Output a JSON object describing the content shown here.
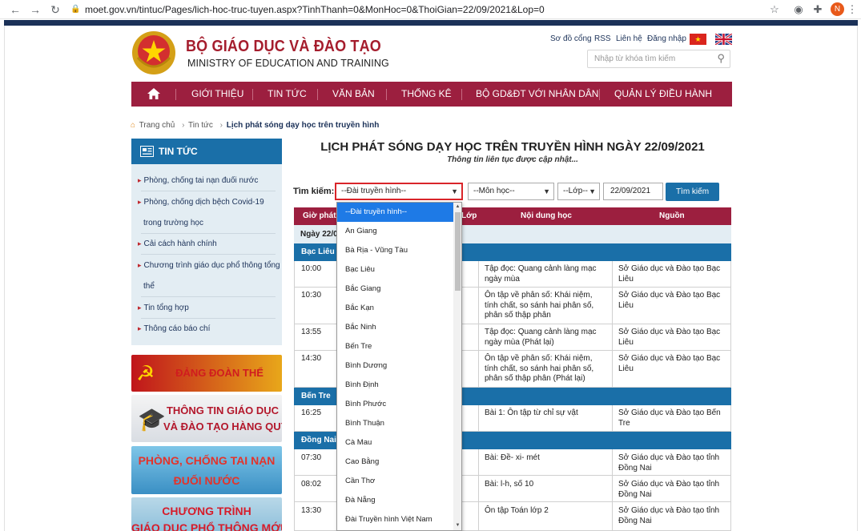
{
  "browser": {
    "url": "moet.gov.vn/tintuc/Pages/lich-hoc-truc-tuyen.aspx?TinhThanh=0&MonHoc=0&ThoiGian=22/09/2021&Lop=0",
    "profile_initial": "N"
  },
  "header": {
    "title": "BỘ GIÁO DỤC VÀ ĐÀO TẠO",
    "subtitle": "MINISTRY OF EDUCATION AND TRAINING",
    "links": [
      "Sơ đồ cổng",
      "RSS",
      "Liên hệ",
      "Đăng nhập"
    ],
    "search_placeholder": "Nhập từ khóa tìm kiếm"
  },
  "nav": {
    "items": [
      "GIỚI THIỆU",
      "TIN TỨC",
      "VĂN BẢN",
      "THỐNG KÊ",
      "BỘ GD&ĐT VỚI NHÂN DÂN",
      "QUẢN LÝ ĐIỀU HÀNH"
    ]
  },
  "breadcrumb": {
    "home": "Trang chủ",
    "section": "Tin tức",
    "current": "Lịch phát sóng dạy học trên truyền hình"
  },
  "sidebar": {
    "heading": "TIN TỨC",
    "items": [
      {
        "label": "Phòng, chống tai nạn đuối nước"
      },
      {
        "label": "Phòng, chống dịch bệch Covid-19",
        "label2": "trong trường học"
      },
      {
        "label": "Cải cách hành chính"
      },
      {
        "label": "Chương trình giáo dục phổ thông tổng",
        "label2": "thể"
      },
      {
        "label": "Tin tổng hợp"
      },
      {
        "label": "Thông cáo báo chí"
      }
    ],
    "banners": [
      {
        "line1": "ĐẢNG ĐOÀN THỂ"
      },
      {
        "line1": "THÔNG TIN GIÁO DỤC",
        "line2": "VÀ ĐÀO TẠO HÀNG QUÝ"
      },
      {
        "line1": "PHÒNG, CHỐNG TAI NẠN",
        "line2": "ĐUỐI NƯỚC"
      },
      {
        "line1": "CHƯƠNG TRÌNH",
        "line2": "GIÁO DỤC PHỔ THÔNG MỚI"
      }
    ]
  },
  "content": {
    "title": "LỊCH PHÁT SÓNG DẠY HỌC TRÊN TRUYỀN HÌNH NGÀY 22/09/2021",
    "subtitle": "Thông tin liên tục được cập nhật...",
    "filter_label": "Tìm kiếm:",
    "filters": {
      "dai": "--Đài truyền hình--",
      "mon": "--Môn học--",
      "lop": "--Lớp--",
      "date": "22/09/2021",
      "button": "Tìm kiếm"
    },
    "columns": [
      "Giờ phát",
      "Lớp",
      "Nội dung học",
      "Nguồn"
    ],
    "date_row": "Ngày 22/0",
    "groups": [
      {
        "province": "Bạc Liêu",
        "rows": [
          {
            "time": "10:00",
            "content": [
              "Tập đọc: Quang cảnh làng mạc",
              "ngày mùa"
            ],
            "source": [
              "Sở Giáo dục và Đào tạo Bạc",
              "Liêu"
            ]
          },
          {
            "time": "10:30",
            "content": [
              "Ôn tập về phân số: Khái niệm,",
              "tính chất, so sánh hai phân số,",
              "phân số thập phân"
            ],
            "source": [
              "Sở Giáo dục và Đào tạo Bạc",
              "Liêu"
            ]
          },
          {
            "time": "13:55",
            "content": [
              "Tập đọc: Quang cảnh làng mạc",
              "ngày mùa (Phát lại)"
            ],
            "source": [
              "Sở Giáo dục và Đào tạo Bạc",
              "Liêu"
            ]
          },
          {
            "time": "14:30",
            "content": [
              "Ôn tập về phân số: Khái niệm,",
              "tính chất, so sánh hai phân số,",
              "phân số thập phân (Phát lại)"
            ],
            "source": [
              "Sở Giáo dục và Đào tạo Bạc",
              "Liêu"
            ]
          }
        ]
      },
      {
        "province": "Bến Tre",
        "rows": [
          {
            "time": "16:25",
            "content": [
              "Bài 1: Ôn tập từ chỉ sự vật"
            ],
            "source": [
              "Sở Giáo dục và Đào tạo Bến",
              "Tre"
            ]
          }
        ]
      },
      {
        "province": "Đồng Nai",
        "rows": [
          {
            "time": "07:30",
            "content": [
              "Bài: Đề- xi- mét"
            ],
            "source": [
              "Sở Giáo dục và Đào tạo tỉnh",
              "Đồng Nai"
            ]
          },
          {
            "time": "08:02",
            "content": [
              "Bài: l-h, số 10"
            ],
            "source": [
              "Sở Giáo dục và Đào tạo tỉnh",
              "Đồng Nai"
            ]
          },
          {
            "time": "13:30",
            "content": [
              "Ôn tập Toán lớp 2"
            ],
            "source": [
              "Sở Giáo dục và Đào tạo tỉnh",
              "Đồng Nai"
            ]
          }
        ]
      }
    ]
  },
  "dropdown": {
    "options": [
      "--Đài truyền hình--",
      "An Giang",
      "Bà Rịa - Vũng Tàu",
      "Bạc Liêu",
      "Bắc Giang",
      "Bắc Kạn",
      "Bắc Ninh",
      "Bến Tre",
      "Bình Dương",
      "Bình Định",
      "Bình Phước",
      "Bình Thuận",
      "Cà Mau",
      "Cao Bằng",
      "Cần Thơ",
      "Đà Nẵng",
      "Đài Truyền hình Việt Nam"
    ],
    "selected_index": 0
  },
  "colors": {
    "navy": "#1b3158",
    "crimson": "#9c1f3f",
    "blue": "#1a6fa8",
    "highlight": "#d9252a"
  }
}
